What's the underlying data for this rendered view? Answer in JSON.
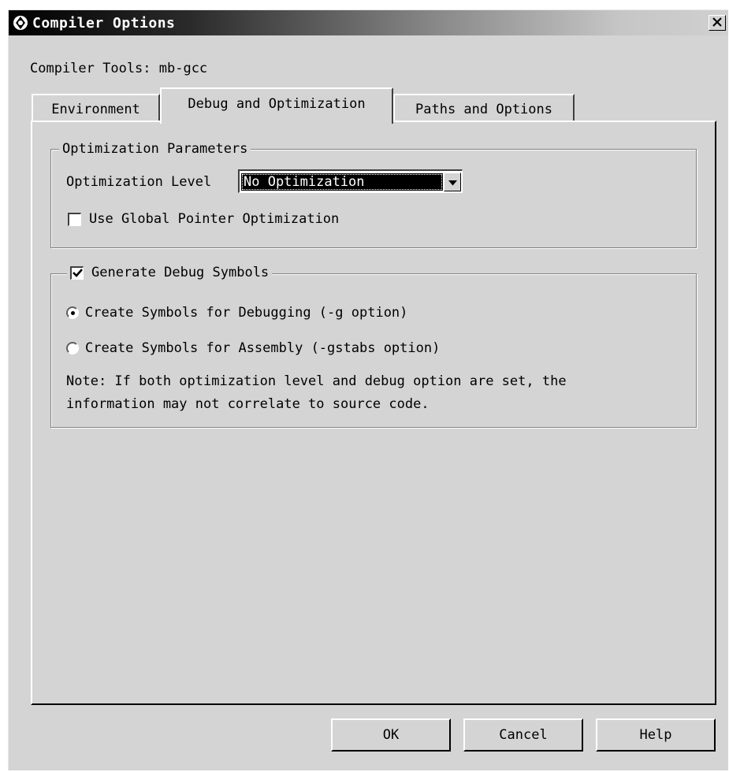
{
  "window": {
    "title": "Compiler Options",
    "close_glyph": "✕"
  },
  "compiler_tools_label": "Compiler Tools: mb-gcc",
  "tabs": [
    {
      "label": "Environment",
      "active": false
    },
    {
      "label": "Debug and Optimization",
      "active": true
    },
    {
      "label": "Paths and Options",
      "active": false
    }
  ],
  "optimization_group": {
    "legend": "Optimization Parameters",
    "level_label": "Optimization Level",
    "level_value": "No Optimization",
    "global_pointer_label": "Use Global Pointer Optimization",
    "global_pointer_checked": false
  },
  "debug_group": {
    "legend": "Generate Debug Symbols",
    "enabled": true,
    "radio_debugging": "Create Symbols for Debugging (-g option)",
    "radio_assembly": "Create Symbols for Assembly (-gstabs option)",
    "selected": "debugging",
    "note_line1": "Note: If both optimization level and debug option are set, the",
    "note_line2": "information may not correlate to source code."
  },
  "buttons": {
    "ok": "OK",
    "cancel": "Cancel",
    "help": "Help"
  }
}
